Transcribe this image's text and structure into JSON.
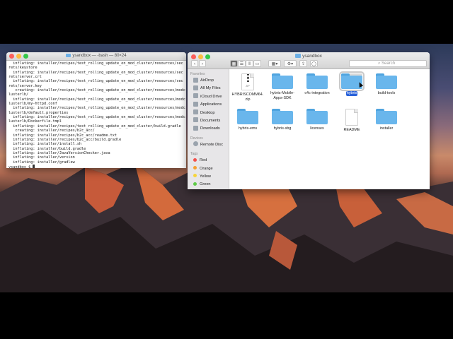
{
  "terminal": {
    "title": "ysandbox — -bash — 80×24",
    "lines": [
      "  inflating: installer/recipes/test_rolling_update_on_mod_cluster/resources/sec",
      "rets/keystore",
      "  inflating: installer/recipes/test_rolling_update_on_mod_cluster/resources/sec",
      "rets/server.crt",
      "  inflating: installer/recipes/test_rolling_update_on_mod_cluster/resources/sec",
      "rets/server.key",
      "   creating: installer/recipes/test_rolling_update_on_mod_cluster/resources/modc",
      "lusterlb/",
      "  inflating: installer/recipes/test_rolling_update_on_mod_cluster/resources/modc",
      "lusterlb/my-httpd.conf",
      "  inflating: installer/recipes/test_rolling_update_on_mod_cluster/resources/modc",
      "lusterlb/default.properties",
      "  inflating: installer/recipes/test_rolling_update_on_mod_cluster/resources/modc",
      "lusterlb/Dockerfile.tmpl",
      "  inflating: installer/recipes/test_rolling_update_on_mod_cluster/build.gradle",
      "   creating: installer/recipes/b2c_acc/",
      "  inflating: installer/recipes/b2c_acc/readme.txt",
      "  inflating: installer/recipes/b2c_acc/build.gradle",
      "  inflating: installer/install.sh",
      "  inflating: installer/build.gradle",
      "  inflating: installer/JavaVersionChecker.java",
      "  inflating: installer/version",
      "  inflating: installer/gradlew"
    ],
    "prompt": "ysandbox $ "
  },
  "finder": {
    "title": "ysandbox",
    "back": "‹",
    "forward": "›",
    "search_placeholder": "Search",
    "sidebar": {
      "favorites_header": "Favorites",
      "favorites": [
        "AirDrop",
        "All My Files",
        "iCloud Drive",
        "Applications",
        "Desktop",
        "Documents",
        "Downloads"
      ],
      "devices_header": "Devices",
      "devices": [
        "Remote Disc"
      ],
      "tags_header": "Tags",
      "tags": [
        {
          "label": "Red",
          "color": "#f2504b"
        },
        {
          "label": "Orange",
          "color": "#f6a031"
        },
        {
          "label": "Yellow",
          "color": "#f7d53a"
        },
        {
          "label": "Green",
          "color": "#5fcb47"
        }
      ]
    },
    "items": [
      {
        "label": "HYBRISCOMM64.",
        "label2": "zip",
        "kind": "zip",
        "badge": "ZIP"
      },
      {
        "label": "hybris-Mobile-",
        "label2": "Apps-SDK",
        "kind": "folder"
      },
      {
        "label": "c4c-integration",
        "label2": "",
        "kind": "folder"
      },
      {
        "label": "hybris",
        "label2": "",
        "kind": "folder",
        "selected": true
      },
      {
        "label": "build-tools",
        "label2": "",
        "kind": "folder"
      },
      {
        "label": "hybris-ems",
        "label2": "",
        "kind": "folder"
      },
      {
        "label": "hybris-sbg",
        "label2": "",
        "kind": "folder"
      },
      {
        "label": "licenses",
        "label2": "",
        "kind": "folder"
      },
      {
        "label": "README",
        "label2": "",
        "kind": "file"
      },
      {
        "label": "installer",
        "label2": "",
        "kind": "folder"
      }
    ]
  },
  "colors": {
    "close": "#fc605b",
    "minimize": "#fdbc40",
    "zoom": "#34c84a",
    "folder": "#69b6ec",
    "selection": "#2a62d9"
  }
}
